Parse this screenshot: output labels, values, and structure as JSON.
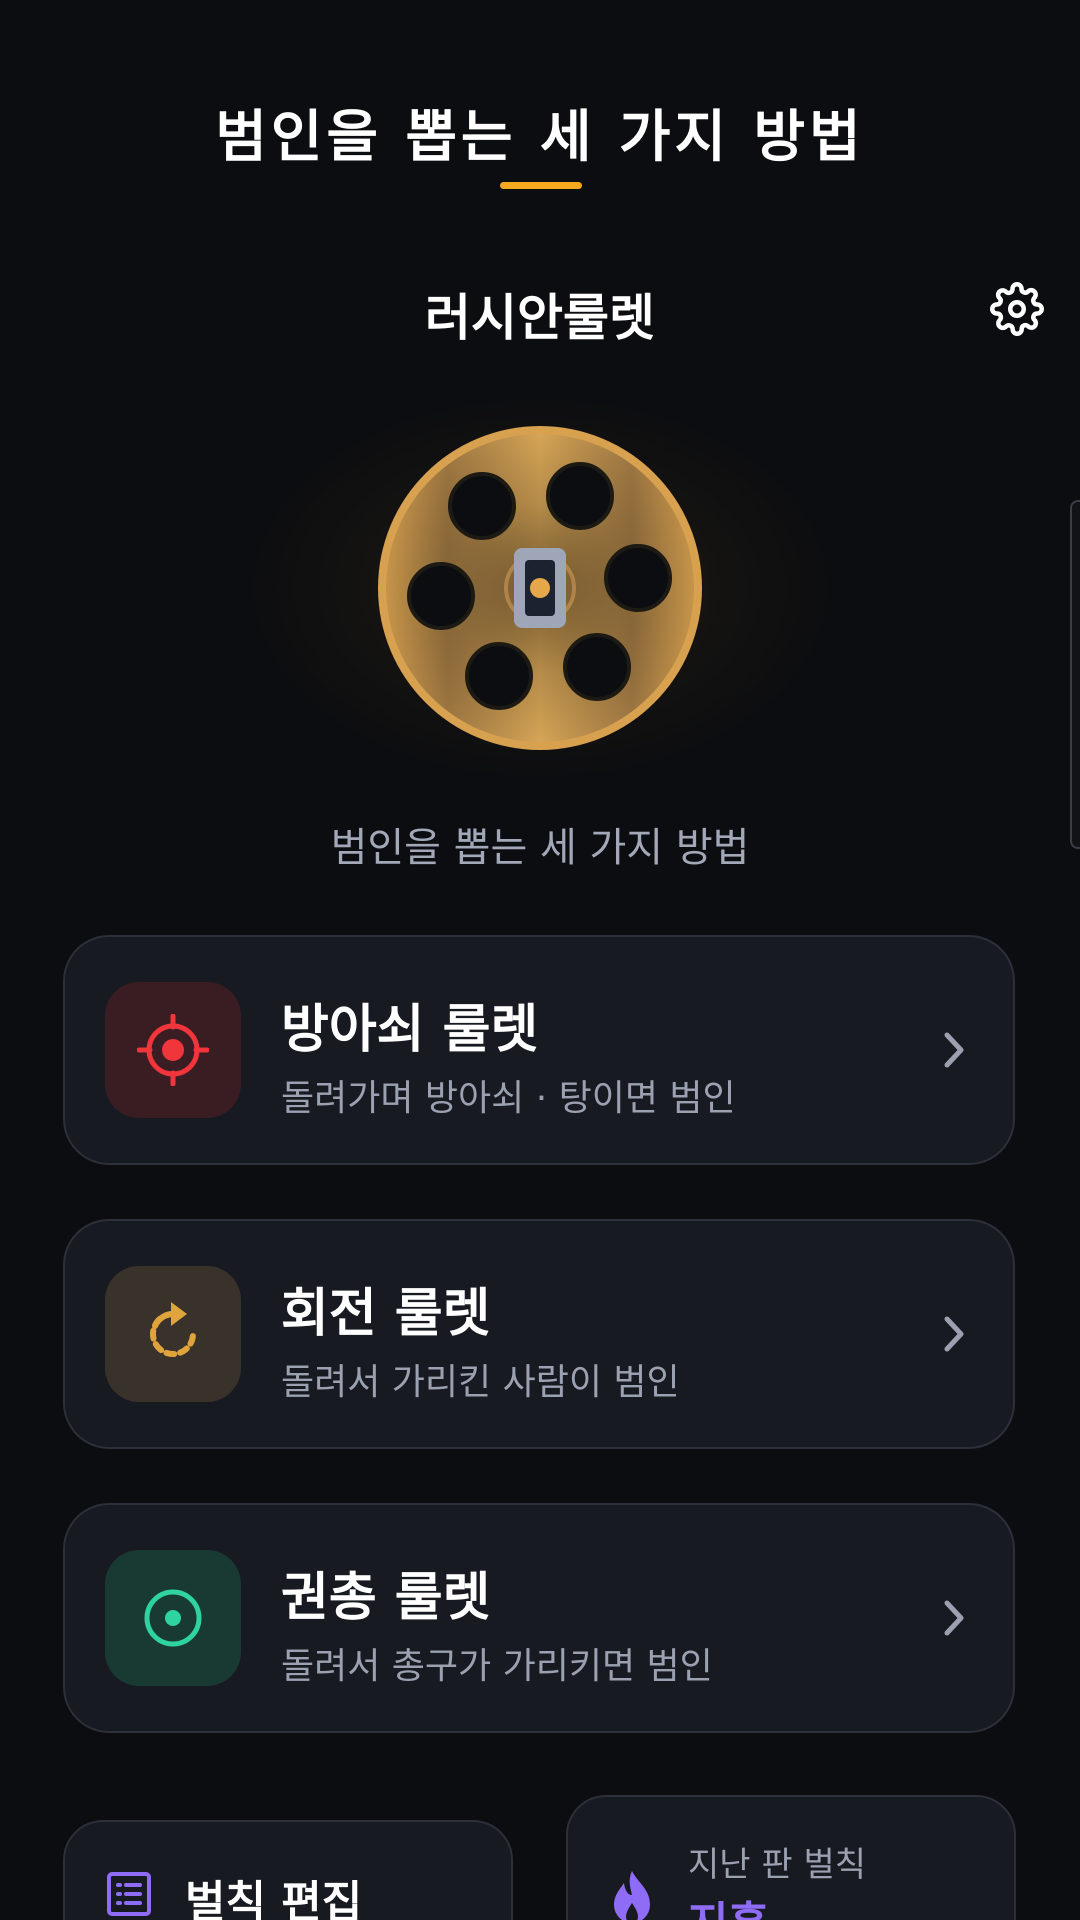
{
  "header": {
    "title": "범인을 뽑는 세 가지 방법",
    "accent_color": "#f4a91c"
  },
  "game": {
    "title": "러시안룰렛",
    "settings_icon": "gear-icon"
  },
  "hero": {
    "subtitle": "범인을 뽑는 세 가지 방법",
    "image": "revolver-cylinder"
  },
  "modes": [
    {
      "title": "방아쇠 룰렛",
      "description": "돌려가며 방아쇠 · 탕이면 범인",
      "icon": "crosshair-icon",
      "icon_color": "#f0353b",
      "icon_bg": "#3a1d22"
    },
    {
      "title": "회전 룰렛",
      "description": "돌려서 가리킨 사람이 범인",
      "icon": "rotate-icon",
      "icon_color": "#e0a43c",
      "icon_bg": "#39322a"
    },
    {
      "title": "권총 룰렛",
      "description": "돌려서 총구가 가리키면 범인",
      "icon": "target-icon",
      "icon_color": "#2ed3a0",
      "icon_bg": "#183a33"
    }
  ],
  "bottom": {
    "rules": {
      "label": "벌칙 편집",
      "icon": "list-icon",
      "icon_color": "#8e6cf5"
    },
    "last_penalty": {
      "label": "지난 판 벌칙",
      "value": "지흥",
      "icon": "fire-icon",
      "value_color": "#8e6cf5"
    }
  }
}
